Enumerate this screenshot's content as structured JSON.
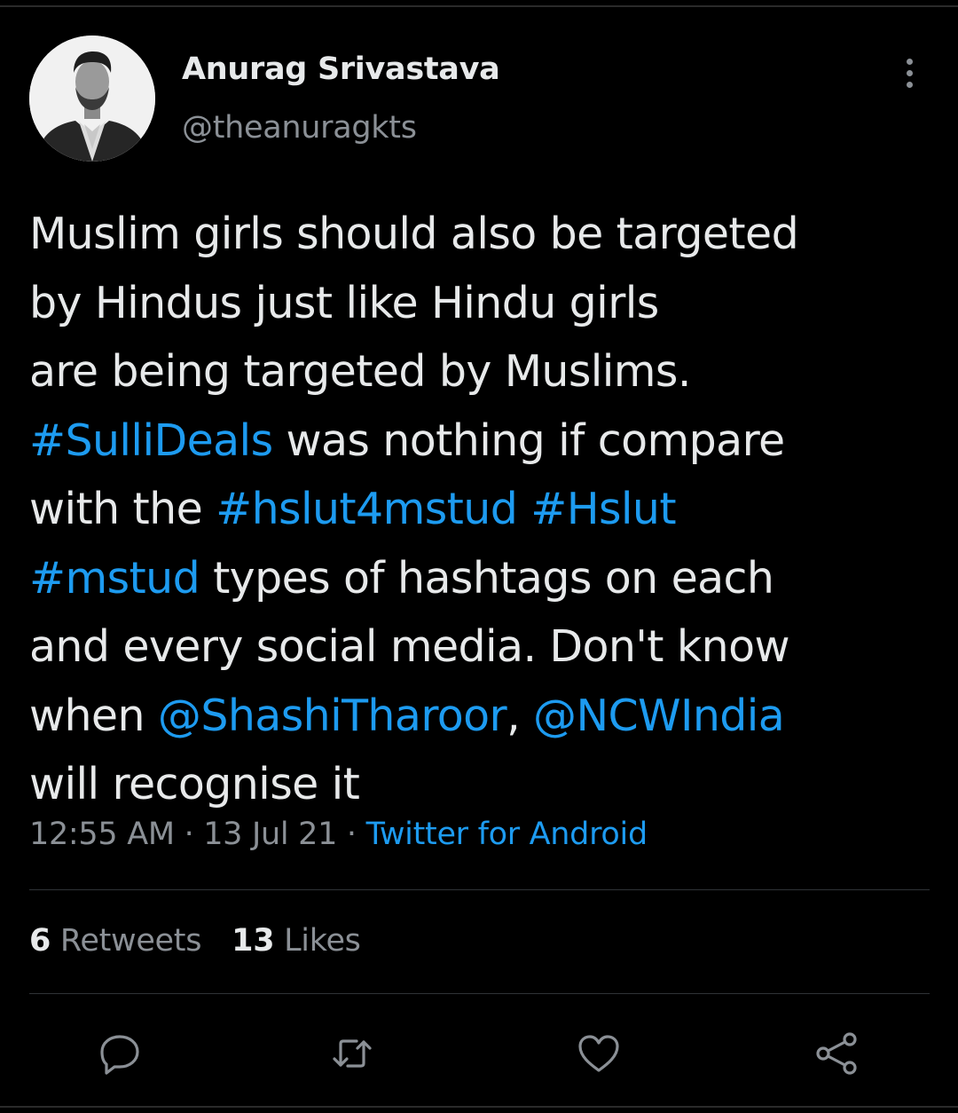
{
  "tweet": {
    "author": {
      "display_name": "Anurag Srivastava",
      "handle": "@theanuragkts"
    },
    "text_lines": [
      [
        {
          "t": "Muslim girls should also be targeted",
          "link": false
        }
      ],
      [
        {
          "t": "by Hindus just like Hindu girls",
          "link": false
        }
      ],
      [
        {
          "t": "are being targeted by Muslims.",
          "link": false
        }
      ],
      [
        {
          "t": "#SulliDeals",
          "link": true
        },
        {
          "t": " was nothing if compare",
          "link": false
        }
      ],
      [
        {
          "t": "with the ",
          "link": false
        },
        {
          "t": "#hslut4mstud",
          "link": true
        },
        {
          "t": " ",
          "link": false
        },
        {
          "t": "#Hslut",
          "link": true
        }
      ],
      [
        {
          "t": "#mstud",
          "link": true
        },
        {
          "t": " types of hashtags on each",
          "link": false
        }
      ],
      [
        {
          "t": "and every social media. Don't know",
          "link": false
        }
      ],
      [
        {
          "t": "when ",
          "link": false
        },
        {
          "t": "@ShashiTharoor",
          "link": true
        },
        {
          "t": ", ",
          "link": false
        },
        {
          "t": "@NCWIndia",
          "link": true
        }
      ],
      [
        {
          "t": "will recognise it",
          "link": false
        }
      ]
    ],
    "time": "12:55 AM",
    "separator": "·",
    "date": "13 Jul 21",
    "source": "Twitter for Android",
    "stats": {
      "retweets_count": "6",
      "retweets_label": "Retweets",
      "likes_count": "13",
      "likes_label": "Likes"
    },
    "actions": [
      {
        "name": "reply-icon"
      },
      {
        "name": "retweet-icon"
      },
      {
        "name": "like-icon"
      },
      {
        "name": "share-icon"
      }
    ]
  },
  "colors": {
    "background": "#000000",
    "text": "#e7e9ea",
    "secondary_text": "#8b9096",
    "link": "#1d9bf0",
    "divider": "#2f3336"
  }
}
